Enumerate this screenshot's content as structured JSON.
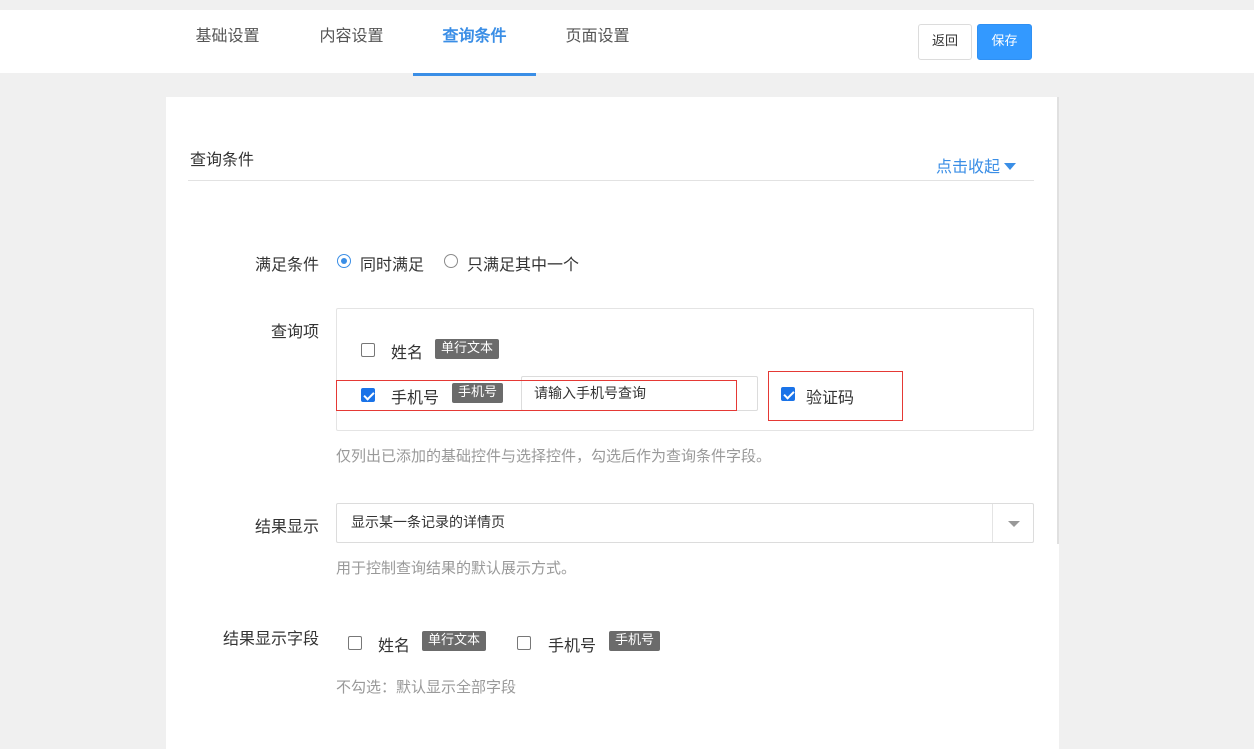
{
  "tabs": [
    {
      "label": "基础设置",
      "active": false
    },
    {
      "label": "内容设置",
      "active": false
    },
    {
      "label": "查询条件",
      "active": true
    },
    {
      "label": "页面设置",
      "active": false
    }
  ],
  "actions": {
    "back_label": "返回",
    "save_label": "保存"
  },
  "section": {
    "title": "查询条件",
    "collapse_label": "点击收起"
  },
  "match_condition": {
    "label": "满足条件",
    "options": [
      {
        "label": "同时满足",
        "checked": true
      },
      {
        "label": "只满足其中一个",
        "checked": false
      }
    ]
  },
  "query_items": {
    "label": "查询项",
    "items": [
      {
        "label": "姓名",
        "tag": "单行文本",
        "checked": false
      },
      {
        "label": "手机号",
        "tag": "手机号",
        "checked": true,
        "input_placeholder": "请输入手机号查询"
      },
      {
        "label": "验证码",
        "checked": true
      }
    ],
    "help": "仅列出已添加的基础控件与选择控件，勾选后作为查询条件字段。"
  },
  "result_display": {
    "label": "结果显示",
    "selected": "显示某一条记录的详情页",
    "help": "用于控制查询结果的默认展示方式。"
  },
  "result_fields": {
    "label": "结果显示字段",
    "items": [
      {
        "label": "姓名",
        "tag": "单行文本",
        "checked": false
      },
      {
        "label": "手机号",
        "tag": "手机号",
        "checked": false
      }
    ],
    "help": "不勾选：默认显示全部字段"
  },
  "colors": {
    "accent": "#3a8ee6",
    "save_button": "#3399ff",
    "highlight_border": "#e53935",
    "tag_bg": "#6b6b6b"
  }
}
